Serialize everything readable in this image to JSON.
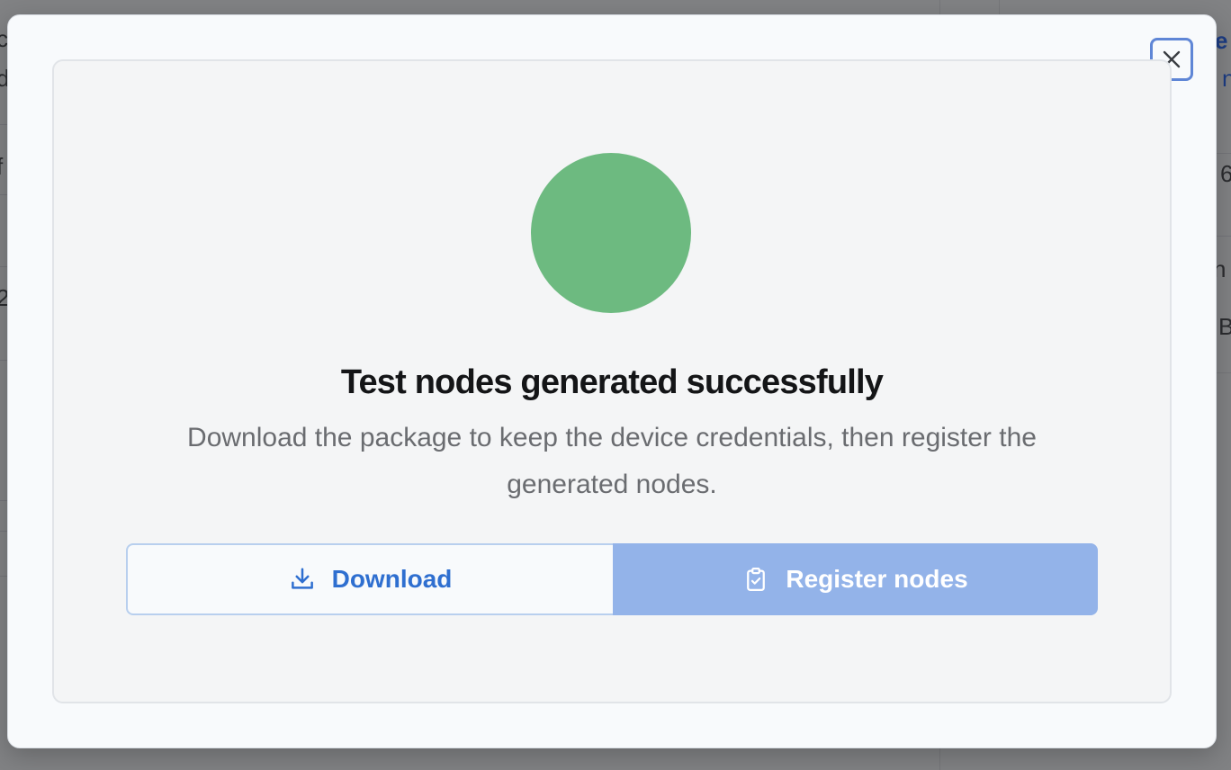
{
  "background": {
    "fragments": [
      "c",
      "d",
      "f",
      "2",
      "e",
      "n",
      "6",
      "n",
      "B"
    ]
  },
  "modal": {
    "title": "Test nodes generated successfully",
    "description": "Download the package to keep the device credentials, then register the generated nodes.",
    "status_color": "#6dba80",
    "close_icon": "close-icon",
    "actions": {
      "download_label": "Download",
      "download_icon": "download-icon",
      "register_label": "Register nodes",
      "register_icon": "clipboard-check-icon"
    }
  }
}
